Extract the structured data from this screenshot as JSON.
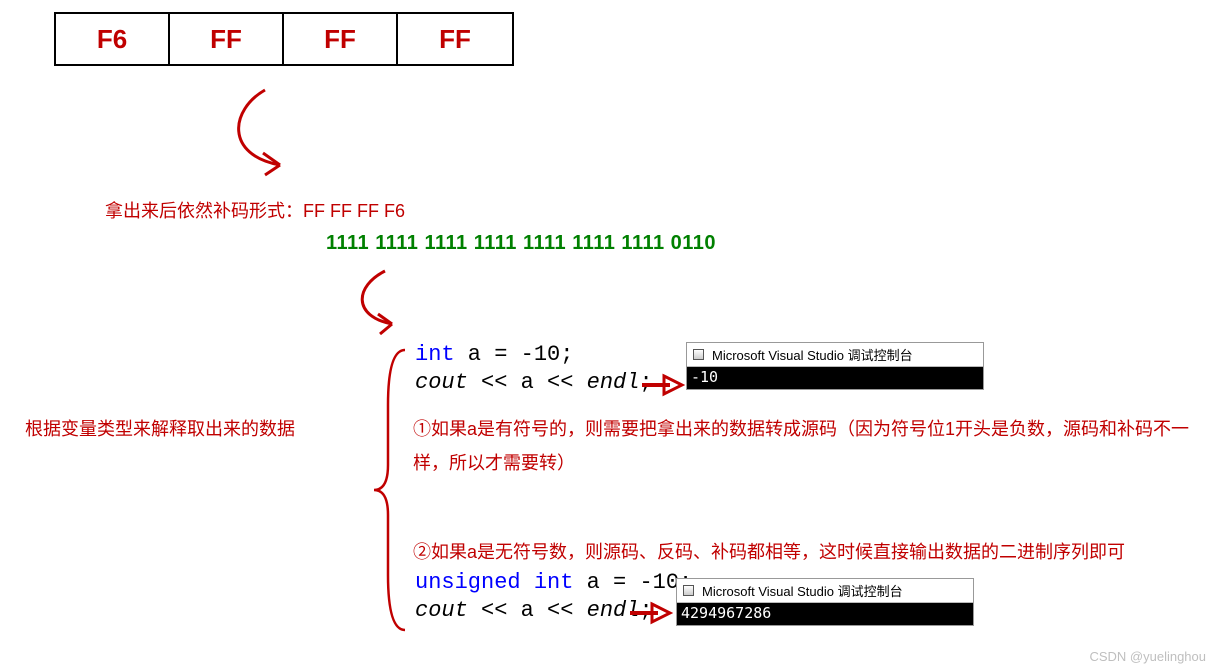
{
  "bytes": {
    "b0": "F6",
    "b1": "FF",
    "b2": "FF",
    "b3": "FF"
  },
  "caption1": "拿出来后依然补码形式：FF FF FF F6",
  "binary": "1111 1111 1111 1111 1111 1111 1111 0110",
  "leftlabel": "根据变量类型来解释取出来的数据",
  "code": {
    "l1_type": "int",
    "l1_rest": " a = -10;",
    "l2_cout": "cout",
    "l2_mid": " << a << ",
    "l2_endl": "endl",
    "l2_semi": ";",
    "l3_type": "unsigned int",
    "l3_rest": " a = -10;",
    "l4_cout": "cout",
    "l4_mid": " << a << ",
    "l4_endl": "endl",
    "l4_semi": ";"
  },
  "redtext1": "①如果a是有符号的，则需要把拿出来的数据转成源码（因为符号位1开头是负数，源码和补码不一样，所以才需要转）",
  "redtext2": "②如果a是无符号数，则源码、反码、补码都相等，这时候直接输出数据的二进制序列即可",
  "console": {
    "title": "Microsoft Visual Studio 调试控制台",
    "out1": "-10",
    "out2": "4294967286"
  },
  "watermark": "CSDN @yuelinghou"
}
